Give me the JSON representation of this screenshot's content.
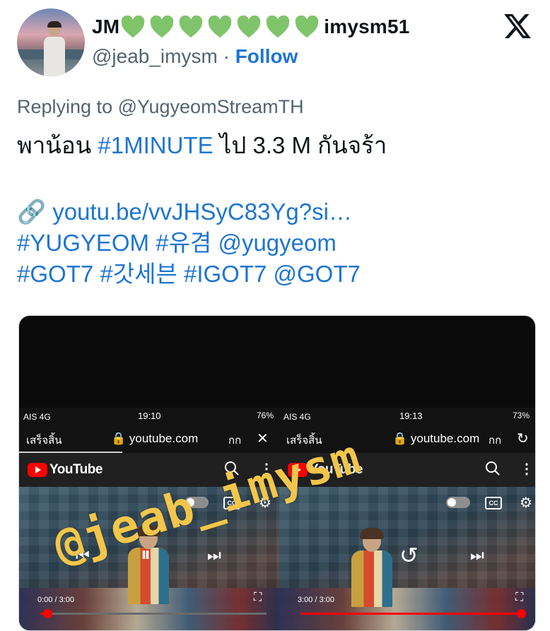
{
  "header": {
    "name_prefix": "JM",
    "name_suffix": "imysm51",
    "heart_count": 7,
    "heart_color": "#7fc46b",
    "handle": "@jeab_imysm",
    "separator": "·",
    "follow_label": "Follow"
  },
  "reply": {
    "text": "Replying to @YugyeomStreamTH"
  },
  "tweet": {
    "l1_a": "พาน้อน ",
    "l1_hashtag": "#1MINUTE",
    "l1_b": " ไป 3.3 M กันจร้า",
    "link_emoji": "🔗",
    "link_text": "youtu.be/vvJHSyC83Yg?si…",
    "tags_line1": "#YUGYEOM  #유겸  @yugyeom",
    "tags_line2": "#GOT7 #갓세븐 #IGOT7  @GOT7"
  },
  "media": {
    "watermark": "@jeab_imysm",
    "left": {
      "carrier": "AIS  4G",
      "time": "19:10",
      "battery": "76%",
      "done_label": "เสร็จสิ้น",
      "url": "youtube.com",
      "text_size_label": "กก",
      "action_icon": "close-icon",
      "yt_label": "YouTube",
      "timecode": "0:00 / 3:00",
      "progress": 0.03
    },
    "right": {
      "carrier": "AIS  4G",
      "time": "19:13",
      "battery": "73%",
      "done_label": "เสร็จสิ้น",
      "url": "youtube.com",
      "text_size_label": "กก",
      "action_icon": "reload-icon",
      "yt_label": "YouTube",
      "timecode": "3:00 / 3:00",
      "progress": 1.0
    }
  },
  "colors": {
    "link": "#1d75d3",
    "muted": "#536471",
    "text": "#0f1419",
    "youtube_red": "#ff0000"
  }
}
